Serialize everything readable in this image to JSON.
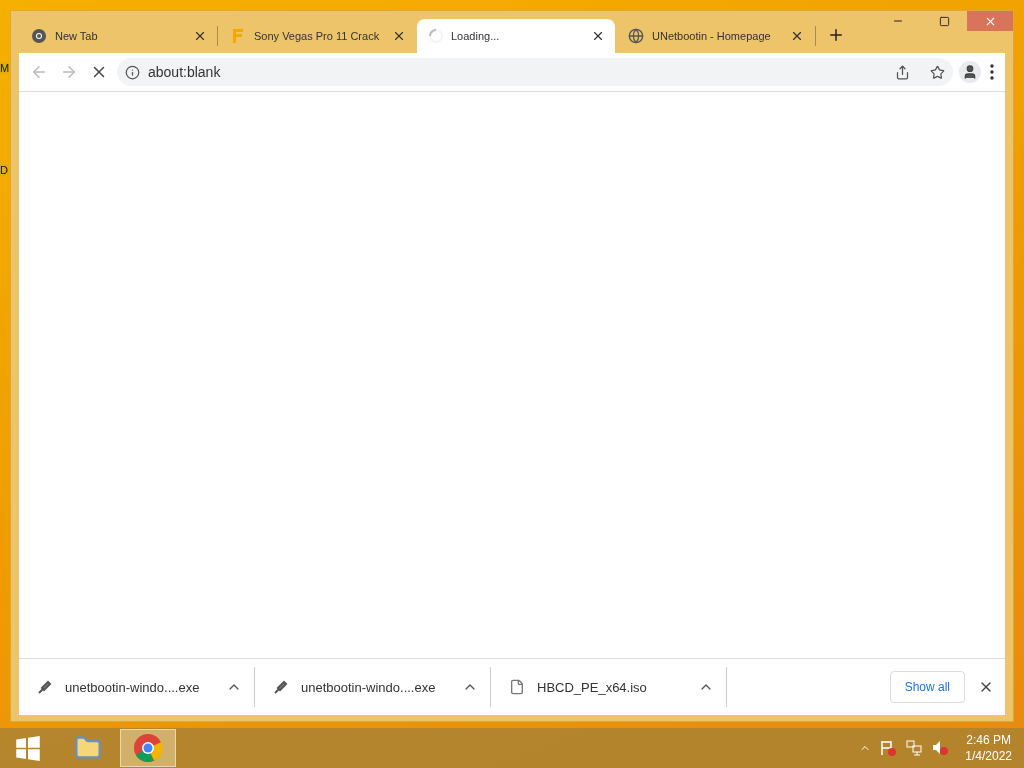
{
  "desktop": {
    "icon_labels": [
      "M",
      "D"
    ]
  },
  "tabs": [
    {
      "title": "New Tab",
      "kind": "chrome",
      "selected": false
    },
    {
      "title": "Sony Vegas Pro 11 Crack",
      "kind": "site",
      "selected": false
    },
    {
      "title": "Loading...",
      "kind": "spinner",
      "selected": true
    },
    {
      "title": "UNetbootin - Homepage",
      "kind": "globe",
      "selected": false
    }
  ],
  "toolbar": {
    "address": "about:blank",
    "loading": true
  },
  "downloads": [
    {
      "name": "unetbootin-windo....exe",
      "kind": "exe"
    },
    {
      "name": "unetbootin-windo....exe",
      "kind": "exe"
    },
    {
      "name": "HBCD_PE_x64.iso",
      "kind": "iso"
    }
  ],
  "download_bar": {
    "show_all": "Show all"
  },
  "taskbar": {
    "time": "2:46 PM",
    "date": "1/4/2022"
  }
}
